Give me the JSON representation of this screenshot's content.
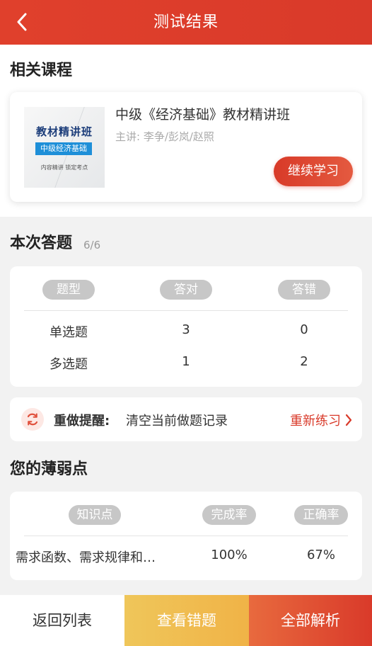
{
  "header": {
    "title": "测试结果"
  },
  "related": {
    "section_title": "相关课程",
    "course": {
      "cover_title": "教材精讲班",
      "cover_subtitle": "中级经济基础",
      "cover_footer": "内容精讲  锁定考点",
      "name": "中级《经济基础》教材精讲班",
      "teacher": "主讲: 李争/彭岚/赵照",
      "continue_label": "继续学习"
    }
  },
  "answers": {
    "section_title": "本次答题",
    "count": "6/6",
    "headers": [
      "题型",
      "答对",
      "答错"
    ],
    "rows": [
      {
        "type": "单选题",
        "correct": "3",
        "wrong": "0"
      },
      {
        "type": "多选题",
        "correct": "1",
        "wrong": "2"
      }
    ]
  },
  "redo": {
    "label": "重做提醒:",
    "text": "清空当前做题记录",
    "link": "重新练习"
  },
  "weak": {
    "section_title": "您的薄弱点",
    "headers": [
      "知识点",
      "完成率",
      "正确率"
    ],
    "rows": [
      {
        "point": "需求函数、需求规律和…",
        "completion": "100%",
        "accuracy": "67%"
      }
    ]
  },
  "bottom": {
    "back_label": "返回列表",
    "wrong_label": "查看错题",
    "all_label": "全部解析"
  },
  "colors": {
    "accent": "#d93a2a",
    "yellow": "#efc65a",
    "pill": "#c7c7c7"
  }
}
